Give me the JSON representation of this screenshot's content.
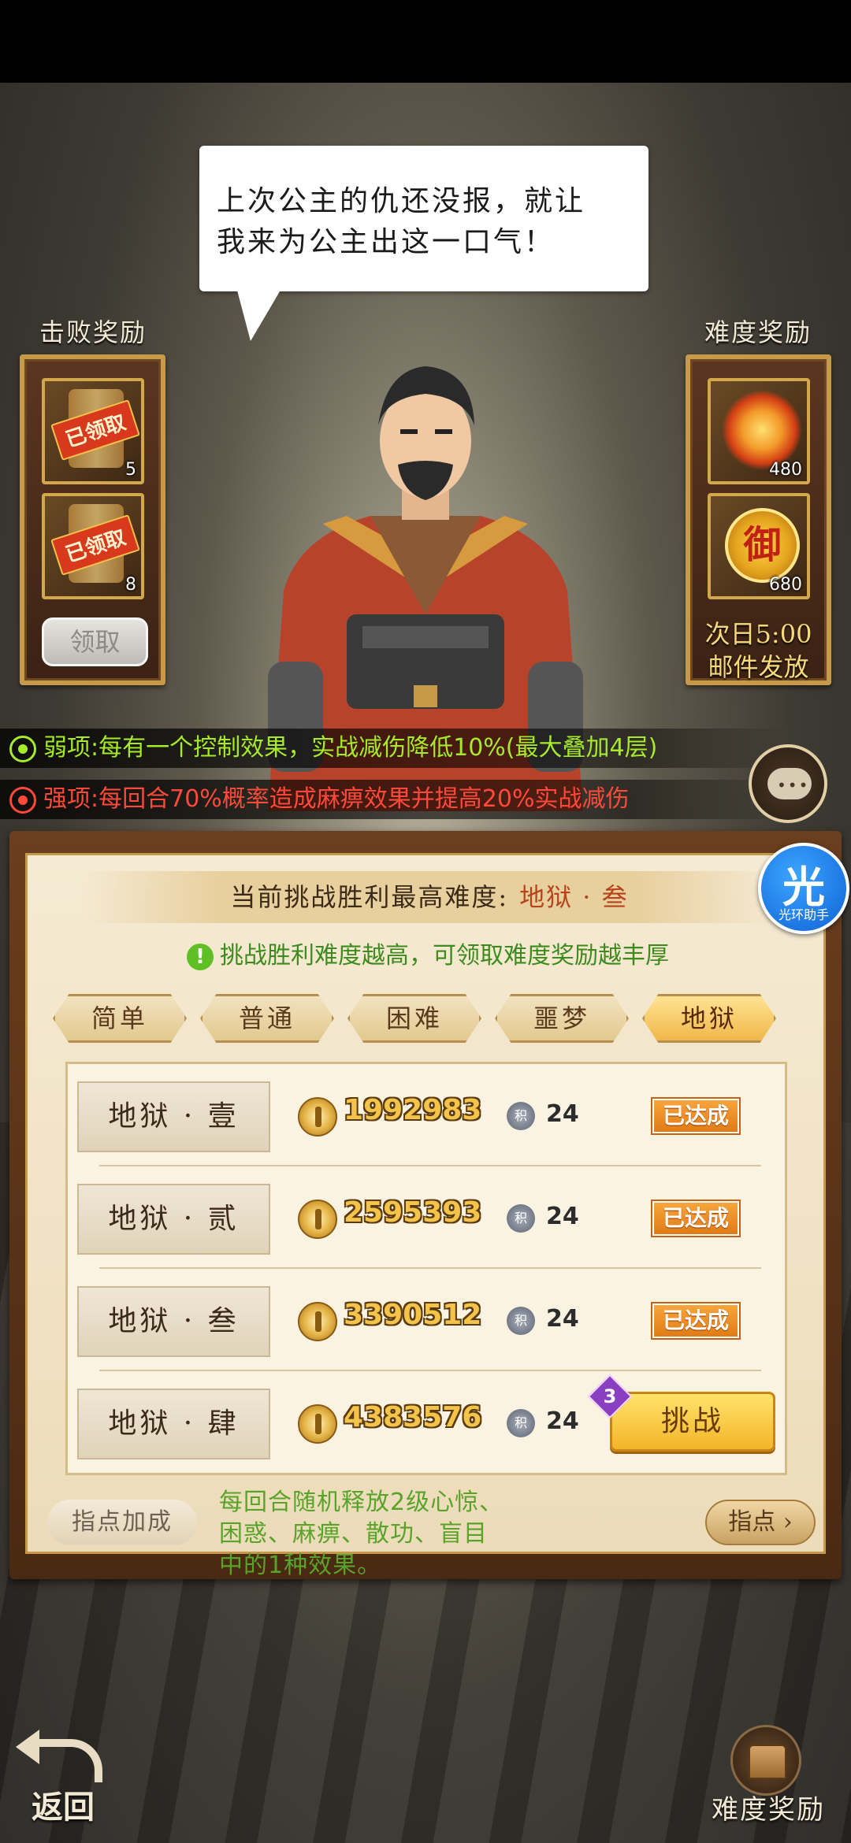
{
  "dialog": {
    "text_line1": "上次公主的仇还没报，就让",
    "text_line2": "我来为公主出这一口气！"
  },
  "left_panel": {
    "title": "击败奖励",
    "slots": [
      {
        "status": "已领取",
        "count": "5"
      },
      {
        "status": "已领取",
        "count": "8"
      }
    ],
    "claim_button": "领取"
  },
  "right_panel": {
    "title": "难度奖励",
    "slots": [
      {
        "icon": "flame-flower-icon",
        "count": "480"
      },
      {
        "icon": "imperial-token-icon",
        "glyph": "御",
        "count": "680"
      }
    ],
    "next_day_line1": "次日5:00",
    "next_day_line2": "邮件发放"
  },
  "traits": {
    "weak": "弱项:每有一个控制效果，实战减伤降低10%(最大叠加4层)",
    "strong": "强项:每回合70%概率造成麻痹效果并提高20%实战减伤"
  },
  "challenge": {
    "current_label": "当前挑战胜利最高难度:",
    "current_value": "地狱 · 叁",
    "hint_icon": "!",
    "hint": "挑战胜利难度越高，可领取难度奖励越丰厚",
    "tabs": [
      {
        "label": "简单",
        "active": false
      },
      {
        "label": "普通",
        "active": false
      },
      {
        "label": "困难",
        "active": false
      },
      {
        "label": "噩梦",
        "active": false
      },
      {
        "label": "地狱",
        "active": true
      }
    ],
    "levels": [
      {
        "name": "地狱 · 壹",
        "power": "1992983",
        "points_icon": "积",
        "points": "24",
        "status": "已达成"
      },
      {
        "name": "地狱 · 贰",
        "power": "2595393",
        "points_icon": "积",
        "points": "24",
        "status": "已达成"
      },
      {
        "name": "地狱 · 叁",
        "power": "3390512",
        "points_icon": "积",
        "points": "24",
        "status": "已达成"
      },
      {
        "name": "地狱 · 肆",
        "power": "4383576",
        "points_icon": "积",
        "points": "24",
        "button": "挑战",
        "badge": "3"
      }
    ],
    "guide_label": "指点加成",
    "guide_desc": "每回合随机释放2级心惊、困惑、麻痹、散功、盲目中的1种效果。",
    "guide_button": "指点 ›"
  },
  "assistant": {
    "big": "光",
    "small": "光环助手"
  },
  "nav": {
    "back": "返回",
    "difficulty_reward": "难度奖励"
  },
  "colors": {
    "weak": "#a6ea2a",
    "strong": "#ff4a3a",
    "highlight": "#b5441c",
    "done": "#e07b16"
  }
}
